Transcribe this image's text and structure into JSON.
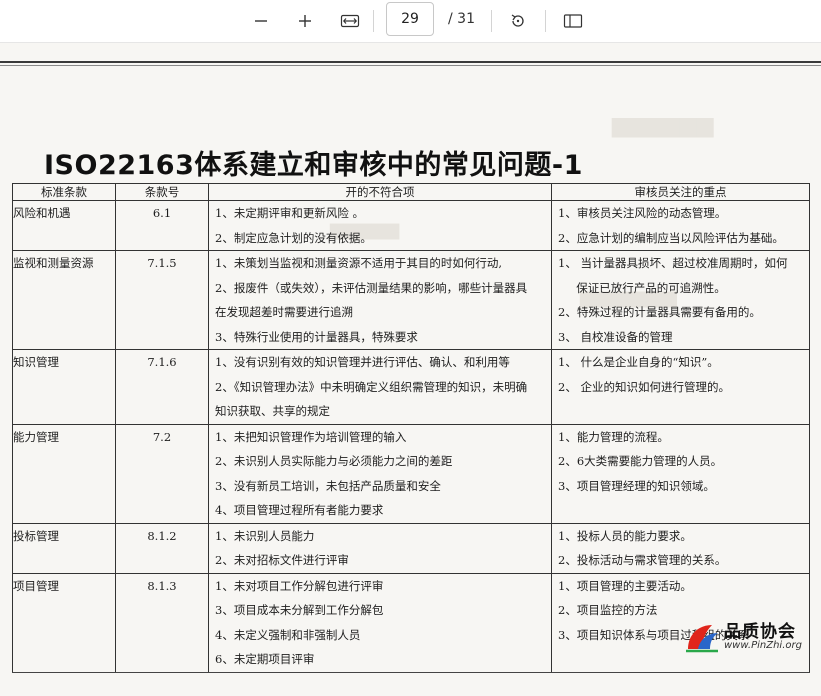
{
  "toolbar": {
    "zoom_out_icon": "minus-icon",
    "zoom_in_icon": "plus-icon",
    "fit_width_icon": "fit-width-icon",
    "page_number": "29",
    "page_total": "/ 31",
    "rotate_icon": "rotate-icon",
    "page_view_icon": "page-view-icon"
  },
  "document": {
    "title": "ISO22163体系建立和审核中的常见问题-1",
    "table": {
      "headers": [
        "标准条款",
        "条款号",
        "开的不符合项",
        "审核员关注的重点"
      ],
      "rows": [
        {
          "standard": "风险和机遇",
          "clause": "6.1",
          "nonconformities": [
            "1、未定期评审和更新风险 。",
            "2、制定应急计划的没有依据。"
          ],
          "focus": [
            "1、审核员关注风险的动态管理。",
            "2、应急计划的编制应当以风险评估为基础。"
          ]
        },
        {
          "standard": "监视和测量资源",
          "clause": "7.1.5",
          "nonconformities": [
            "1、未策划当监视和测量资源不适用于其目的时如何行动,",
            "2、报废件（或失效），未评估测量结果的影响，哪些计量器具",
            "在发现超差时需要进行追溯",
            "3、特殊行业使用的计量器具，特殊要求"
          ],
          "focus": [
            "1、 当计量器具损坏、超过校准周期时，如何",
            "     保证已放行产品的可追溯性。",
            "2、特殊过程的计量器具需要有备用的。",
            "3、 自校准设备的管理"
          ]
        },
        {
          "standard": "知识管理",
          "clause": "7.1.6",
          "nonconformities": [
            "1、没有识别有效的知识管理并进行评估、确认、和利用等",
            "2、《知识管理办法》中未明确定义组织需管理的知识，未明确",
            "知识获取、共享的规定"
          ],
          "focus": [
            "1、 什么是企业自身的“知识”。",
            "2、 企业的知识如何进行管理的。"
          ]
        },
        {
          "standard": "能力管理",
          "clause": "7.2",
          "nonconformities": [
            "1、未把知识管理作为培训管理的输入",
            "2、未识别人员实际能力与必须能力之间的差距",
            "3、没有新员工培训，未包括产品质量和安全",
            "4、项目管理过程所有者能力要求"
          ],
          "focus": [
            "1、能力管理的流程。",
            "2、6大类需要能力管理的人员。",
            "3、项目管理经理的知识领域。"
          ]
        },
        {
          "standard": "投标管理",
          "clause": "8.1.2",
          "nonconformities": [
            "1、未识别人员能力",
            "2、未对招标文件进行评审"
          ],
          "focus": [
            "1、投标人员的能力要求。",
            "2、投标活动与需求管理的关系。"
          ]
        },
        {
          "standard": "项目管理",
          "clause": "8.1.3",
          "nonconformities": [
            "1、未对项目工作分解包进行评审",
            "3、项目成本未分解到工作分解包",
            "4、未定义强制和非强制人员",
            "6、未定期项目评审"
          ],
          "focus": [
            "1、项目管理的主要活动。",
            "2、项目监控的方法",
            "3、项目知识体系与项目过程组的关系"
          ]
        }
      ]
    }
  },
  "watermark": {
    "logo_icon": "pinzhi-logo-icon",
    "name": "品质协会",
    "url": "www.PinZhi.org"
  }
}
